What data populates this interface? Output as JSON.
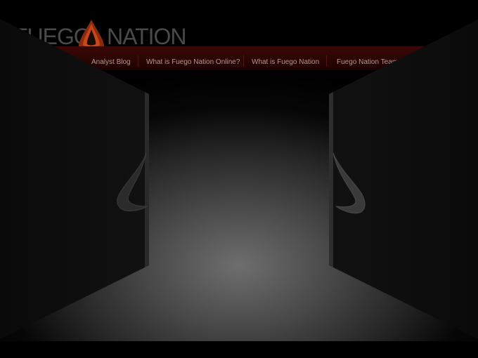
{
  "brand": {
    "logo_left": "FUEGO",
    "logo_right": "NATION"
  },
  "nav": {
    "items": [
      {
        "label": "Analyst Blog"
      },
      {
        "label": "What is Fuego Nation Online?"
      },
      {
        "label": "What is Fuego Nation"
      },
      {
        "label": "Fuego Nation Team"
      }
    ]
  },
  "colors": {
    "nav_background": "#2a0402",
    "nav_text": "#b29a8e",
    "logo_text": "#4a4a4a",
    "flame_orange": "#c8471a",
    "door": "#151515",
    "floor_glow": "#6e6e6e"
  },
  "icons": {
    "flame": "flame-icon",
    "left_door_handle": "door-handle-icon",
    "right_door_handle": "door-handle-icon"
  }
}
